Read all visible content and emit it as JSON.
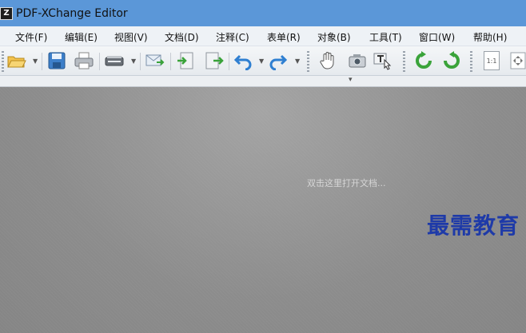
{
  "window": {
    "title": "PDF-XChange Editor",
    "icon_name": "app-logo-icon"
  },
  "menu": {
    "items": [
      "文件(F)",
      "编辑(E)",
      "视图(V)",
      "文档(D)",
      "注释(C)",
      "表单(R)",
      "对象(B)",
      "工具(T)",
      "窗口(W)",
      "帮助(H)"
    ]
  },
  "toolbar": {
    "icons": [
      "open-folder-icon",
      "save-icon",
      "print-icon",
      "scan-icon",
      "email-icon",
      "import-icon",
      "export-icon",
      "undo-icon",
      "redo-icon",
      "hand-tool-icon",
      "snapshot-icon",
      "select-text-icon",
      "rotate-left-icon",
      "rotate-right-icon",
      "actual-size-icon",
      "fit-page-icon"
    ],
    "actual_size_label": "1:1"
  },
  "workspace": {
    "hint": "双击这里打开文档..."
  },
  "watermark": {
    "text": "最需教育",
    "color": "#1e3aa8"
  },
  "colors": {
    "titlebar": "#5b97d8",
    "workspace": "#8e8e8e",
    "accent_green": "#3aa33a",
    "accent_blue": "#2f7fd1"
  }
}
